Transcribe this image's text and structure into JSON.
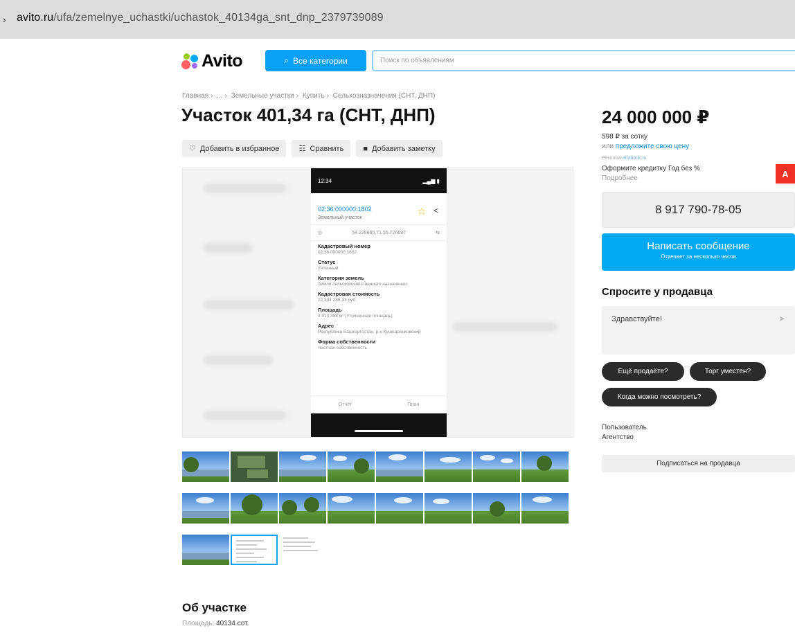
{
  "browser": {
    "url_host": "avito.ru",
    "url_path": "/ufa/zemelnye_uchastki/uchastok_40134ga_snt_dnp_2379739089"
  },
  "header": {
    "logo_text": "Avito",
    "categories_label": "Все категории",
    "search_placeholder": "Поиск по объявлениям"
  },
  "breadcrumbs": [
    "Главная",
    "...",
    "Земельные участки",
    "Купить",
    "Сельхозназначения (СНТ, ДНП)"
  ],
  "listing": {
    "title": "Участок 401,34 га (СНТ, ДНП)",
    "actions": {
      "favorite": "Добавить в избранное",
      "compare": "Сравнить",
      "note": "Добавить заметку"
    }
  },
  "phone_screenshot": {
    "time": "12:34",
    "cadastral_id": "02:36:000000:1802",
    "object_type": "Земельный участок",
    "coords": "54.229865,71.55.726697",
    "fields": [
      {
        "label": "Кадастровый номер",
        "value": "02:36:000000:1802"
      },
      {
        "label": "Статус",
        "value": "Учтенный"
      },
      {
        "label": "Категория земель",
        "value": "Земли сельскохозяйственного назначения"
      },
      {
        "label": "Кадастровая стоимость",
        "value": "22 334 285,33 руб."
      },
      {
        "label": "Площадь",
        "value": "4 013 458 м² (Уточненная площадь)"
      },
      {
        "label": "Адрес",
        "value": "Республика Башкортостан, р-н Кушнаренковский"
      },
      {
        "label": "Форма собственности",
        "value": "Частная собственность"
      }
    ],
    "tabs": [
      "Отчёт",
      "План"
    ]
  },
  "sidebar": {
    "price": "24 000 000 ₽",
    "price_per": "598 ₽ за сотку",
    "offer_prefix": "или",
    "offer_link": "предложите свою цену",
    "ad_label": "Реклама",
    "ad_source": "alfabank.ru",
    "ad_text": "Оформите кредитку Год без %",
    "ad_more": "Подробнее",
    "ad_badge": "А",
    "phone": "8 917 790-78-05",
    "message_label": "Написать сообщение",
    "message_sub": "Отвечает за несколько часов",
    "ask_title": "Спросите у продавца",
    "ask_default": "Здравствуйте!",
    "chips": [
      "Ещё продаёте?",
      "Торг уместен?",
      "Когда можно посмотреть?"
    ],
    "seller_name": "Пользователь",
    "seller_type": "Агентство",
    "subscribe_label": "Подписаться на продавца"
  },
  "about": {
    "title": "Об участке",
    "area_label": "Площадь:",
    "area_value": "40134 сот."
  },
  "colors": {
    "accent": "#0aa0f5",
    "message": "#03a9f4",
    "alfa": "#ef3124"
  }
}
